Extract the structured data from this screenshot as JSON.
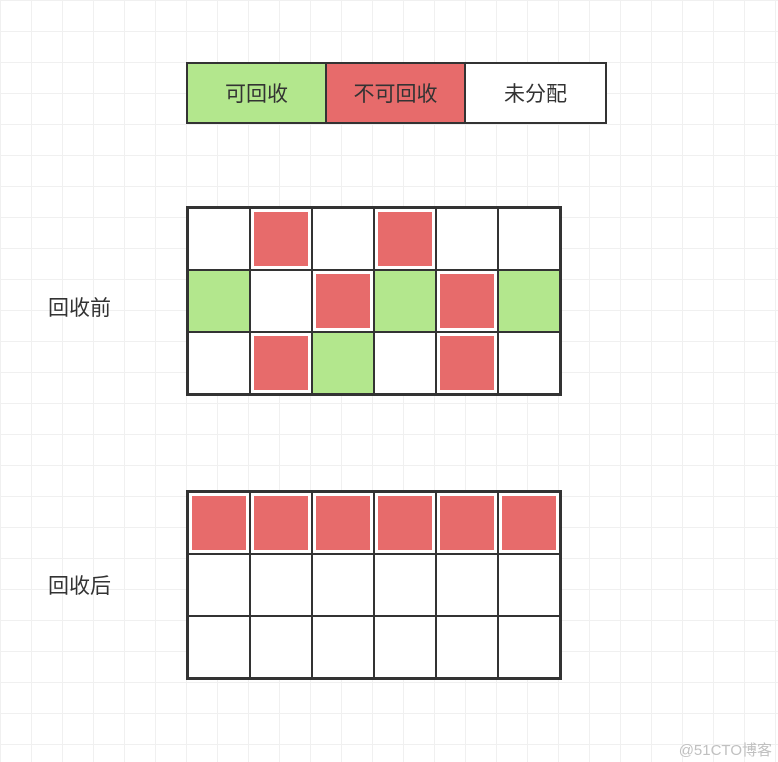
{
  "colors": {
    "recyclable": "#b3e78d",
    "not_recyclable": "#e76b6b",
    "unallocated": "#ffffff"
  },
  "legend": {
    "recyclable": "可回收",
    "not_recyclable": "不可回收",
    "unallocated": "未分配"
  },
  "labels": {
    "before": "回收前",
    "after": "回收后"
  },
  "grids": {
    "before": {
      "rows": 3,
      "cols": 6,
      "cells": [
        [
          "w",
          "r",
          "w",
          "r",
          "w",
          "w"
        ],
        [
          "g",
          "w",
          "r",
          "g",
          "r",
          "g"
        ],
        [
          "w",
          "r",
          "g",
          "w",
          "r",
          "w"
        ]
      ]
    },
    "after": {
      "rows": 3,
      "cols": 6,
      "cells": [
        [
          "r",
          "r",
          "r",
          "r",
          "r",
          "r"
        ],
        [
          "w",
          "w",
          "w",
          "w",
          "w",
          "w"
        ],
        [
          "w",
          "w",
          "w",
          "w",
          "w",
          "w"
        ]
      ]
    }
  },
  "watermark": "@51CTO博客"
}
